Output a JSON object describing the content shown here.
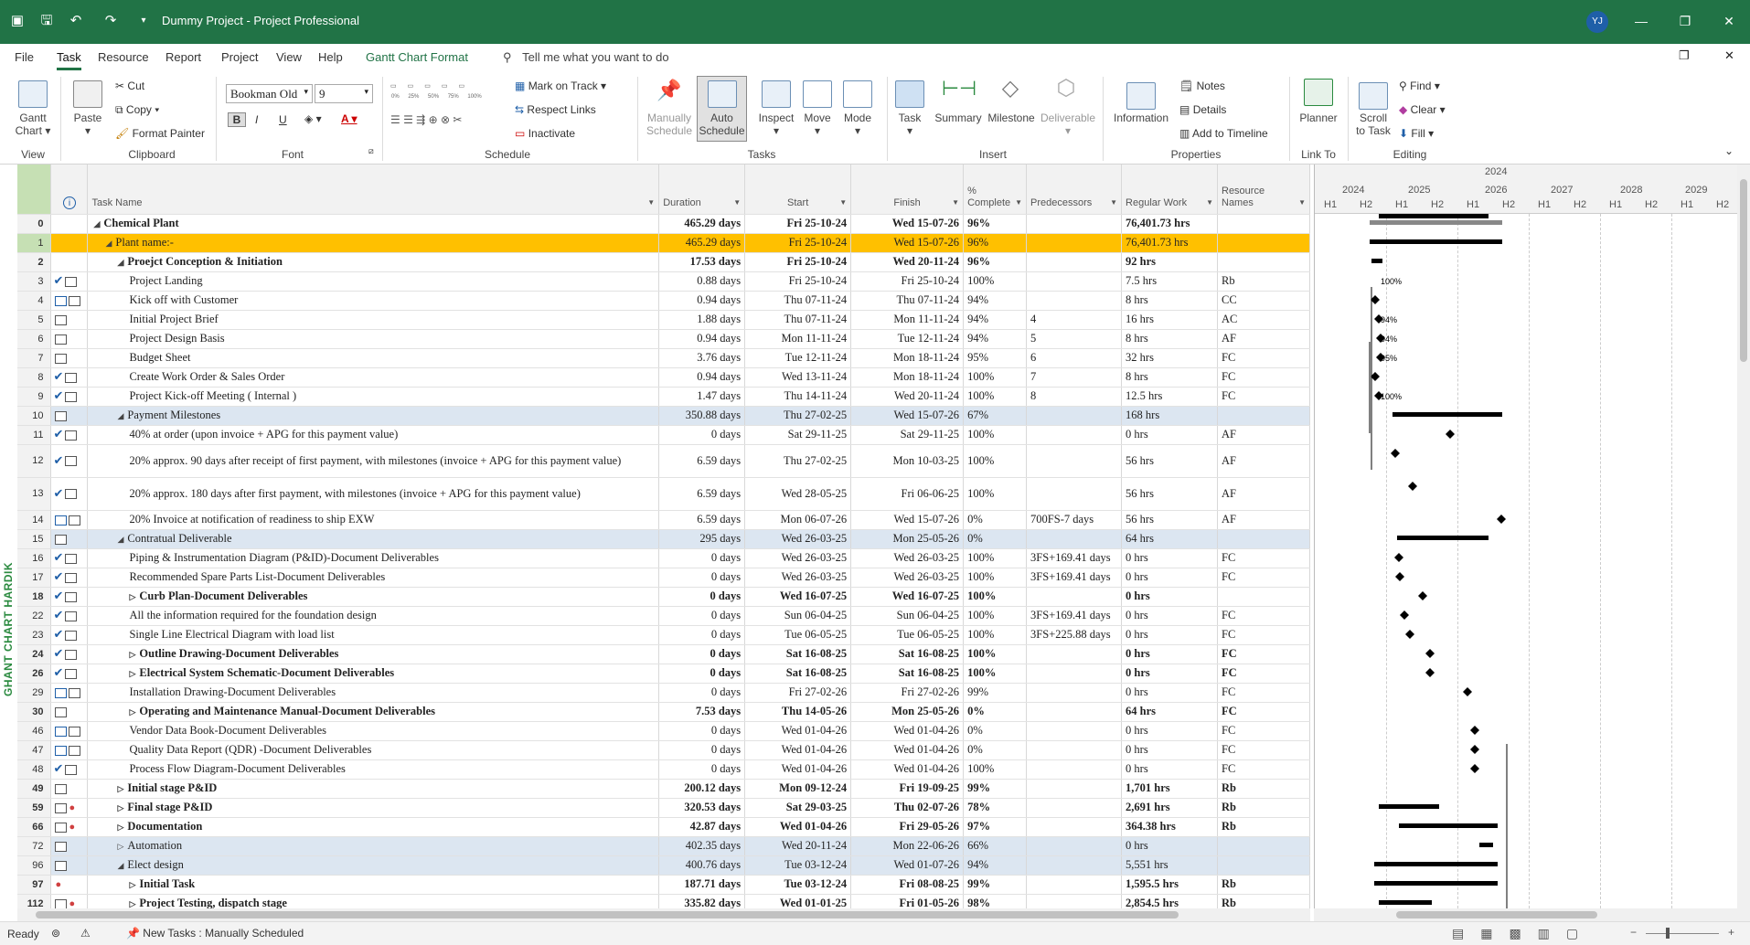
{
  "window": {
    "title": "Dummy Project  -  Project Professional",
    "user_initials": "YJ"
  },
  "tabs": [
    "File",
    "Task",
    "Resource",
    "Report",
    "Project",
    "View",
    "Help",
    "Gantt Chart Format"
  ],
  "tell_me": "Tell me what you want to do",
  "ribbon": {
    "view": {
      "gantt": "Gantt",
      "chart": "Chart",
      "group": "View"
    },
    "clipboard": {
      "paste": "Paste",
      "cut": "Cut",
      "copy": "Copy",
      "format_painter": "Format Painter",
      "group": "Clipboard"
    },
    "font": {
      "name": "Bookman Old",
      "size": "9",
      "group": "Font"
    },
    "schedule": {
      "mark_on_track": "Mark on Track",
      "respect_links": "Respect Links",
      "inactivate": "Inactivate",
      "group": "Schedule",
      "pcts": [
        "0%",
        "25%",
        "50%",
        "75%",
        "100%"
      ]
    },
    "tasks": {
      "manually": "Manually",
      "schedule": "Schedule",
      "auto": "Auto",
      "auto_schedule": "Schedule",
      "inspect": "Inspect",
      "move": "Move",
      "mode": "Mode",
      "group": "Tasks"
    },
    "insert": {
      "task": "Task",
      "summary": "Summary",
      "milestone": "Milestone",
      "deliverable": "Deliverable",
      "group": "Insert"
    },
    "properties": {
      "information": "Information",
      "notes": "Notes",
      "details": "Details",
      "add_to_timeline": "Add to Timeline",
      "group": "Properties"
    },
    "link_to": {
      "planner": "Planner",
      "group": "Link To"
    },
    "editing": {
      "scroll": "Scroll",
      "to_task": "to Task",
      "find": "Find",
      "clear": "Clear",
      "fill": "Fill",
      "group": "Editing"
    }
  },
  "side_label": "GHANT CHART HARDIK",
  "columns": {
    "task_name": "Task Name",
    "duration": "Duration",
    "start": "Start",
    "finish": "Finish",
    "pct_1": "%",
    "pct_2": "Complete",
    "predecessors": "Predecessors",
    "regular_work": "Regular Work",
    "resource_1": "Resource",
    "resource_2": "Names"
  },
  "rows": [
    {
      "id": "0",
      "chk": "",
      "mode": "",
      "name": "Chemical Plant",
      "lvl": 0,
      "summary": true,
      "exp": "◢",
      "dur": "465.29 days",
      "start": "Fri 25-10-24",
      "finish": "Wed 15-07-26",
      "pct": "96%",
      "pred": "",
      "work": "76,401.73 hrs",
      "res": "",
      "style": "sum"
    },
    {
      "id": "1",
      "chk": "",
      "mode": "",
      "name": "Plant name:-",
      "lvl": 1,
      "summary": true,
      "exp": "◢",
      "dur": "465.29 days",
      "start": "Fri 25-10-24",
      "finish": "Wed 15-07-26",
      "pct": "96%",
      "pred": "",
      "work": "76,401.73 hrs",
      "res": "",
      "style": "hl"
    },
    {
      "id": "2",
      "chk": "",
      "mode": "",
      "name": "Proejct Conception & Initiation",
      "lvl": 2,
      "summary": true,
      "exp": "◢",
      "dur": "17.53 days",
      "start": "Fri 25-10-24",
      "finish": "Wed 20-11-24",
      "pct": "96%",
      "pred": "",
      "work": "92 hrs",
      "res": "",
      "style": "sum"
    },
    {
      "id": "3",
      "chk": "✔",
      "mode": "t",
      "name": "Project Landing",
      "lvl": 3,
      "dur": "0.88 days",
      "start": "Fri 25-10-24",
      "finish": "Fri 25-10-24",
      "pct": "100%",
      "pred": "",
      "work": "7.5 hrs",
      "res": "Rb"
    },
    {
      "id": "4",
      "chk": "",
      "mode": "tt",
      "name": "Kick off with Customer",
      "lvl": 3,
      "dur": "0.94 days",
      "start": "Thu 07-11-24",
      "finish": "Thu 07-11-24",
      "pct": "94%",
      "pred": "",
      "work": "8 hrs",
      "res": "CC"
    },
    {
      "id": "5",
      "chk": "",
      "mode": "t",
      "name": "Initial Project Brief",
      "lvl": 3,
      "dur": "1.88 days",
      "start": "Thu 07-11-24",
      "finish": "Mon 11-11-24",
      "pct": "94%",
      "pred": "4",
      "work": "16 hrs",
      "res": "AC"
    },
    {
      "id": "6",
      "chk": "",
      "mode": "t",
      "name": "Project Design Basis",
      "lvl": 3,
      "dur": "0.94 days",
      "start": "Mon 11-11-24",
      "finish": "Tue 12-11-24",
      "pct": "94%",
      "pred": "5",
      "work": "8 hrs",
      "res": "AF"
    },
    {
      "id": "7",
      "chk": "",
      "mode": "t",
      "name": "Budget Sheet",
      "lvl": 3,
      "dur": "3.76 days",
      "start": "Tue 12-11-24",
      "finish": "Mon 18-11-24",
      "pct": "95%",
      "pred": "6",
      "work": "32 hrs",
      "res": "FC"
    },
    {
      "id": "8",
      "chk": "✔",
      "mode": "t",
      "name": "Create Work Order & Sales Order",
      "lvl": 3,
      "dur": "0.94 days",
      "start": "Wed 13-11-24",
      "finish": "Mon 18-11-24",
      "pct": "100%",
      "pred": "7",
      "work": "8 hrs",
      "res": "FC"
    },
    {
      "id": "9",
      "chk": "✔",
      "mode": "t",
      "name": "Project Kick-off Meeting ( Internal )",
      "lvl": 3,
      "dur": "1.47 days",
      "start": "Thu 14-11-24",
      "finish": "Wed 20-11-24",
      "pct": "100%",
      "pred": "8",
      "work": "12.5 hrs",
      "res": "FC"
    },
    {
      "id": "10",
      "chk": "",
      "mode": "t",
      "name": "Payment Milestones",
      "lvl": 2,
      "summary": true,
      "exp": "◢",
      "dur": "350.88 days",
      "start": "Thu 27-02-25",
      "finish": "Wed 15-07-26",
      "pct": "67%",
      "pred": "",
      "work": "168 hrs",
      "res": "",
      "style": "band"
    },
    {
      "id": "11",
      "chk": "✔",
      "mode": "t",
      "name": "40% at order (upon invoice + APG for this payment value)",
      "lvl": 3,
      "dur": "0 days",
      "start": "Sat 29-11-25",
      "finish": "Sat 29-11-25",
      "pct": "100%",
      "pred": "",
      "work": "0 hrs",
      "res": "AF"
    },
    {
      "id": "12",
      "chk": "✔",
      "mode": "t",
      "name": "20% approx. 90 days after receipt of first payment, with milestones (invoice + APG for this payment value)",
      "lvl": 3,
      "tall": true,
      "dur": "6.59 days",
      "start": "Thu 27-02-25",
      "finish": "Mon 10-03-25",
      "pct": "100%",
      "pred": "",
      "work": "56 hrs",
      "res": "AF"
    },
    {
      "id": "13",
      "chk": "✔",
      "mode": "t",
      "name": "20% approx. 180 days after first payment, with milestones (invoice + APG for this payment value)",
      "lvl": 3,
      "tall": true,
      "dur": "6.59 days",
      "start": "Wed 28-05-25",
      "finish": "Fri 06-06-25",
      "pct": "100%",
      "pred": "",
      "work": "56 hrs",
      "res": "AF"
    },
    {
      "id": "14",
      "chk": "",
      "mode": "tt",
      "name": "20% Invoice at notification of readiness to ship EXW",
      "lvl": 3,
      "dur": "6.59 days",
      "start": "Mon 06-07-26",
      "finish": "Wed 15-07-26",
      "pct": "0%",
      "pred": "700FS-7 days",
      "work": "56 hrs",
      "res": "AF"
    },
    {
      "id": "15",
      "chk": "",
      "mode": "t",
      "name": "Contratual Deliverable",
      "lvl": 2,
      "summary": true,
      "exp": "◢",
      "dur": "295 days",
      "start": "Wed 26-03-25",
      "finish": "Mon 25-05-26",
      "pct": "0%",
      "pred": "",
      "work": "64 hrs",
      "res": "",
      "style": "band"
    },
    {
      "id": "16",
      "chk": "✔",
      "mode": "t",
      "name": "Piping & Instrumentation Diagram (P&ID)-Document Deliverables",
      "lvl": 3,
      "dur": "0 days",
      "start": "Wed 26-03-25",
      "finish": "Wed 26-03-25",
      "pct": "100%",
      "pred": "3FS+169.41 days",
      "work": "0 hrs",
      "res": "FC"
    },
    {
      "id": "17",
      "chk": "✔",
      "mode": "t",
      "name": "Recommended Spare Parts List-Document Deliverables",
      "lvl": 3,
      "dur": "0 days",
      "start": "Wed 26-03-25",
      "finish": "Wed 26-03-25",
      "pct": "100%",
      "pred": "3FS+169.41 days",
      "work": "0 hrs",
      "res": "FC"
    },
    {
      "id": "18",
      "chk": "✔",
      "mode": "t",
      "name": "Curb Plan-Document Deliverables",
      "lvl": 3,
      "summary": true,
      "exp": "▷",
      "dur": "0 days",
      "start": "Wed 16-07-25",
      "finish": "Wed 16-07-25",
      "pct": "100%",
      "pred": "",
      "work": "0 hrs",
      "res": "",
      "style": "sum"
    },
    {
      "id": "22",
      "chk": "✔",
      "mode": "t",
      "name": "All the information required for the foundation design",
      "lvl": 3,
      "dur": "0 days",
      "start": "Sun 06-04-25",
      "finish": "Sun 06-04-25",
      "pct": "100%",
      "pred": "3FS+169.41 days",
      "work": "0 hrs",
      "res": "FC"
    },
    {
      "id": "23",
      "chk": "✔",
      "mode": "t",
      "name": "Single Line Electrical Diagram with load list",
      "lvl": 3,
      "dur": "0 days",
      "start": "Tue 06-05-25",
      "finish": "Tue 06-05-25",
      "pct": "100%",
      "pred": "3FS+225.88 days",
      "work": "0 hrs",
      "res": "FC"
    },
    {
      "id": "24",
      "chk": "✔",
      "mode": "t",
      "name": "Outline Drawing-Document Deliverables",
      "lvl": 3,
      "summary": true,
      "exp": "▷",
      "dur": "0 days",
      "start": "Sat 16-08-25",
      "finish": "Sat 16-08-25",
      "pct": "100%",
      "pred": "",
      "work": "0 hrs",
      "res": "FC",
      "style": "sum"
    },
    {
      "id": "26",
      "chk": "✔",
      "mode": "t",
      "name": "Electrical System Schematic-Document Deliverables",
      "lvl": 3,
      "summary": true,
      "exp": "▷",
      "dur": "0 days",
      "start": "Sat 16-08-25",
      "finish": "Sat 16-08-25",
      "pct": "100%",
      "pred": "",
      "work": "0 hrs",
      "res": "FC",
      "style": "sum"
    },
    {
      "id": "29",
      "chk": "",
      "mode": "tt",
      "name": "Installation Drawing-Document Deliverables",
      "lvl": 3,
      "dur": "0 days",
      "start": "Fri 27-02-26",
      "finish": "Fri 27-02-26",
      "pct": "99%",
      "pred": "",
      "work": "0 hrs",
      "res": "FC"
    },
    {
      "id": "30",
      "chk": "",
      "mode": "t",
      "name": "Operating and Maintenance Manual-Document Deliverables",
      "lvl": 3,
      "summary": true,
      "exp": "▷",
      "dur": "7.53 days",
      "start": "Thu 14-05-26",
      "finish": "Mon 25-05-26",
      "pct": "0%",
      "pred": "",
      "work": "64 hrs",
      "res": "FC",
      "style": "sum"
    },
    {
      "id": "46",
      "chk": "",
      "mode": "tt",
      "name": "Vendor Data Book-Document Deliverables",
      "lvl": 3,
      "dur": "0 days",
      "start": "Wed 01-04-26",
      "finish": "Wed 01-04-26",
      "pct": "0%",
      "pred": "",
      "work": "0 hrs",
      "res": "FC"
    },
    {
      "id": "47",
      "chk": "",
      "mode": "tt",
      "name": "Quality Data Report (QDR) -Document Deliverables",
      "lvl": 3,
      "dur": "0 days",
      "start": "Wed 01-04-26",
      "finish": "Wed 01-04-26",
      "pct": "0%",
      "pred": "",
      "work": "0 hrs",
      "res": "FC"
    },
    {
      "id": "48",
      "chk": "✔",
      "mode": "t",
      "name": "Process Flow Diagram-Document Deliverables",
      "lvl": 3,
      "dur": "0 days",
      "start": "Wed 01-04-26",
      "finish": "Wed 01-04-26",
      "pct": "100%",
      "pred": "",
      "work": "0 hrs",
      "res": "FC"
    },
    {
      "id": "49",
      "chk": "",
      "mode": "t",
      "name": "Initial stage P&ID",
      "lvl": 2,
      "summary": true,
      "exp": "▷",
      "dur": "200.12 days",
      "start": "Mon 09-12-24",
      "finish": "Fri 19-09-25",
      "pct": "99%",
      "pred": "",
      "work": "1,701 hrs",
      "res": "Rb",
      "style": "sum"
    },
    {
      "id": "59",
      "chk": "",
      "mode": "tp",
      "name": "Final stage P&ID",
      "lvl": 2,
      "summary": true,
      "exp": "▷",
      "dur": "320.53 days",
      "start": "Sat 29-03-25",
      "finish": "Thu 02-07-26",
      "pct": "78%",
      "pred": "",
      "work": "2,691 hrs",
      "res": "Rb",
      "style": "sum"
    },
    {
      "id": "66",
      "chk": "",
      "mode": "tp",
      "name": "Documentation",
      "lvl": 2,
      "summary": true,
      "exp": "▷",
      "dur": "42.87 days",
      "start": "Wed 01-04-26",
      "finish": "Fri 29-05-26",
      "pct": "97%",
      "pred": "",
      "work": "364.38 hrs",
      "res": "Rb",
      "style": "sum"
    },
    {
      "id": "72",
      "chk": "",
      "mode": "t",
      "name": "Automation",
      "lvl": 2,
      "summary": true,
      "exp": "▷",
      "dur": "402.35 days",
      "start": "Wed 20-11-24",
      "finish": "Mon 22-06-26",
      "pct": "66%",
      "pred": "",
      "work": "0 hrs",
      "res": "",
      "style": "band"
    },
    {
      "id": "96",
      "chk": "",
      "mode": "t",
      "name": "Elect design",
      "lvl": 2,
      "summary": true,
      "exp": "◢",
      "dur": "400.76 days",
      "start": "Tue 03-12-24",
      "finish": "Wed 01-07-26",
      "pct": "94%",
      "pred": "",
      "work": "5,551 hrs",
      "res": "",
      "style": "band"
    },
    {
      "id": "97",
      "chk": "",
      "mode": "p",
      "name": "Initial Task",
      "lvl": 3,
      "summary": true,
      "exp": "▷",
      "dur": "187.71 days",
      "start": "Tue 03-12-24",
      "finish": "Fri 08-08-25",
      "pct": "99%",
      "pred": "",
      "work": "1,595.5 hrs",
      "res": "Rb",
      "style": "sum"
    },
    {
      "id": "112",
      "chk": "",
      "mode": "tp",
      "name": "Project Testing, dispatch stage",
      "lvl": 3,
      "summary": true,
      "exp": "▷",
      "dur": "335.82 days",
      "start": "Wed 01-01-25",
      "finish": "Fri 01-05-26",
      "pct": "98%",
      "pred": "",
      "work": "2,854.5 hrs",
      "res": "Rb",
      "style": "sum"
    }
  ],
  "gantt": {
    "top_year": "2024",
    "years": [
      "2024",
      "2025",
      "2026",
      "2027",
      "2028",
      "2029"
    ],
    "halves": [
      "H1",
      "H2",
      "H1",
      "H2",
      "H1",
      "H2",
      "H1",
      "H2",
      "H1",
      "H2",
      "H1",
      "H2"
    ],
    "bar_labels": [
      "100%",
      "94%",
      "94%",
      "95%",
      "100%"
    ]
  },
  "status": {
    "ready": "Ready",
    "new_tasks": "New Tasks : Manually Scheduled"
  }
}
